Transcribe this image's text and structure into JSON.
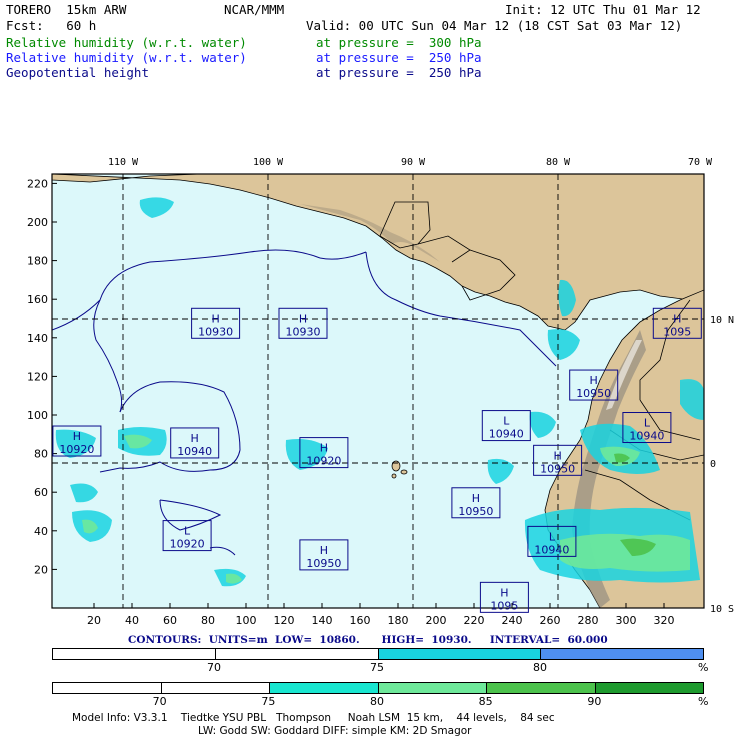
{
  "header": {
    "model": "TORERO  15km ARW",
    "org": "NCAR/MMM",
    "init": "Init: 12 UTC Thu 01 Mar 12",
    "fcst": "Fcst:   60 h",
    "valid": "Valid: 00 UTC Sun 04 Mar 12 (18 CST Sat 03 Mar 12)",
    "fields": [
      {
        "name": "Relative humidity (w.r.t. water)",
        "level": "at pressure =  300 hPa",
        "color": "#008a00"
      },
      {
        "name": "Relative humidity (w.r.t. water)",
        "level": "at pressure =  250 hPa",
        "color": "#1a1aff"
      },
      {
        "name": "Geopotential height",
        "level": "at pressure =  250 hPa",
        "color": "#0a0a8a"
      }
    ]
  },
  "map": {
    "lon_labels": [
      "110 W",
      "100 W",
      "90 W",
      "80 W",
      "70 W"
    ],
    "lat_labels": [
      "10 N",
      "0",
      "10 S"
    ],
    "y_ticks": [
      "220",
      "200",
      "180",
      "160",
      "140",
      "120",
      "100",
      "80",
      "60",
      "40",
      "20"
    ],
    "x_ticks": [
      "20",
      "40",
      "60",
      "80",
      "100",
      "120",
      "140",
      "160",
      "180",
      "200",
      "220",
      "240",
      "260",
      "280",
      "300",
      "320"
    ],
    "centers": [
      {
        "type": "H",
        "value": "10930",
        "gx": 84,
        "gy": 147
      },
      {
        "type": "H",
        "value": "10930",
        "gx": 130,
        "gy": 147
      },
      {
        "type": "H",
        "value": "10920",
        "gx": 11,
        "gy": 86
      },
      {
        "type": "H",
        "value": "10940",
        "gx": 73,
        "gy": 85
      },
      {
        "type": "H",
        "value": "10920",
        "gx": 141,
        "gy": 80
      },
      {
        "type": "L",
        "value": "10920",
        "gx": 69,
        "gy": 37
      },
      {
        "type": "H",
        "value": "10950",
        "gx": 141,
        "gy": 27
      },
      {
        "type": "L",
        "value": "10940",
        "gx": 237,
        "gy": 94
      },
      {
        "type": "H",
        "value": "10950",
        "gx": 221,
        "gy": 54
      },
      {
        "type": "H",
        "value": "10950",
        "gx": 283,
        "gy": 115
      },
      {
        "type": "L",
        "value": "10940",
        "gx": 311,
        "gy": 93
      },
      {
        "type": "H",
        "value": "10950",
        "gx": 264,
        "gy": 76
      },
      {
        "type": "L",
        "value": "10940",
        "gx": 261,
        "gy": 34
      },
      {
        "type": "H",
        "value": "1095",
        "gx": 327,
        "gy": 147
      },
      {
        "type": "H",
        "value": "1095",
        "gx": 236,
        "gy": 5
      }
    ]
  },
  "contours": {
    "text": "CONTOURS:  UNITS=m  LOW=  10860.      HIGH=  10930.     INTERVAL=  60.000"
  },
  "colorbar1": {
    "unit": "%",
    "labels": [
      "70",
      "75",
      "80"
    ],
    "colors": [
      "#ffffff",
      "#ffffff",
      "#19d3e0",
      "#4f8ff0"
    ]
  },
  "colorbar2": {
    "unit": "%",
    "labels": [
      "70",
      "75",
      "80",
      "85",
      "90"
    ],
    "colors": [
      "#ffffff",
      "#ffffff",
      "#19e6d0",
      "#6ee89a",
      "#4cc24c",
      "#1e9a2e"
    ]
  },
  "footer": {
    "line1": "Model Info: V3.3.1    Tiedtke YSU PBL   Thompson     Noah LSM  15 km,    44 levels,    84 sec",
    "line2": "LW: Godd SW: Goddard DIFF: simple KM: 2D Smagor"
  }
}
